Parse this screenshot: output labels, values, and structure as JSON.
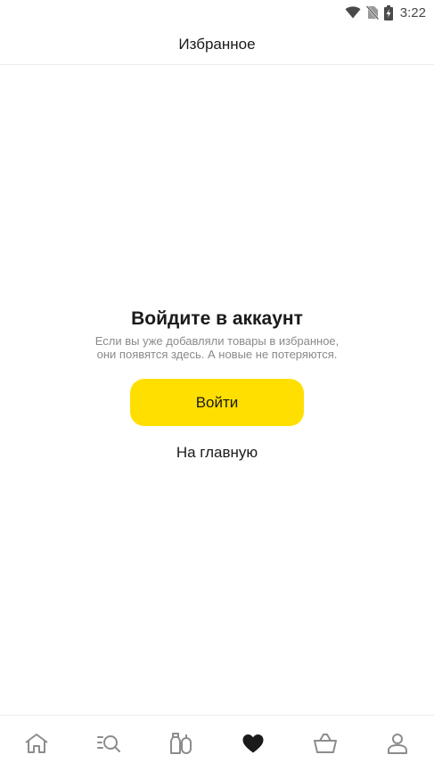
{
  "status_bar": {
    "time": "3:22",
    "icons": [
      "wifi-icon",
      "no-sim-icon",
      "battery-charging-icon"
    ]
  },
  "header": {
    "title": "Избранное"
  },
  "empty_state": {
    "title": "Войдите в аккаунт",
    "description_line1": "Если вы уже добавляли товары в избранное,",
    "description_line2": "они появятся здесь. А новые не потеряются.",
    "login_button": "Войти",
    "home_link": "На главную"
  },
  "bottom_nav": {
    "items": [
      {
        "icon": "home-icon",
        "active": false
      },
      {
        "icon": "catalog-search-icon",
        "active": false
      },
      {
        "icon": "products-icon",
        "active": false
      },
      {
        "icon": "heart-icon",
        "active": true
      },
      {
        "icon": "basket-icon",
        "active": false
      },
      {
        "icon": "profile-icon",
        "active": false
      }
    ]
  },
  "colors": {
    "accent": "#ffdf00",
    "text": "#1a1a1a",
    "muted": "#8a8a8a",
    "icon_inactive": "#8c8c8c"
  }
}
